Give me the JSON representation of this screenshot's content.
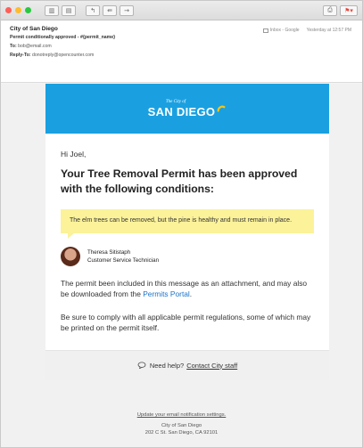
{
  "email": {
    "from": "City of San Diego",
    "subject": "Permit conditionally approved - #{permit_name}",
    "to_label": "To:",
    "to_value": "bob@email.com",
    "reply_label": "Reply-To:",
    "reply_value": "donotreply@opencounter.com",
    "folder": "Inbox - Google",
    "date": "Yesterday at 12:57 PM"
  },
  "banner": {
    "logo_small": "The City of",
    "logo_main": "SAN DIEGO"
  },
  "message": {
    "greeting": "Hi Joel,",
    "title": "Your Tree Removal Permit has been approved with the following conditions:",
    "note": "The elm trees can be removed, but the pine is healthy and must remain in place.",
    "staff_name": "Theresa Sitistaph",
    "staff_role": "Customer Service Technician",
    "para1_text": "The permit been included in this message as an attachment, and may also be downloaded from the",
    "para1_link": "Permits Portal",
    "para1_end": ".",
    "para2": "Be sure to comply with all applicable permit regulations, some of which may be printed on the permit itself.",
    "help_text": "Need help?",
    "help_link": "Contact City staff"
  },
  "footer": {
    "settings_link": "Update your email notification settings.",
    "org": "City of San Diego",
    "address": "202 C St. San Diego, CA 92101"
  },
  "colors": {
    "banner": "#1aa0e0",
    "note": "#fbf29a",
    "link": "#1a73c8",
    "accent_red": "#e8453c",
    "sun": "#f5c518"
  }
}
